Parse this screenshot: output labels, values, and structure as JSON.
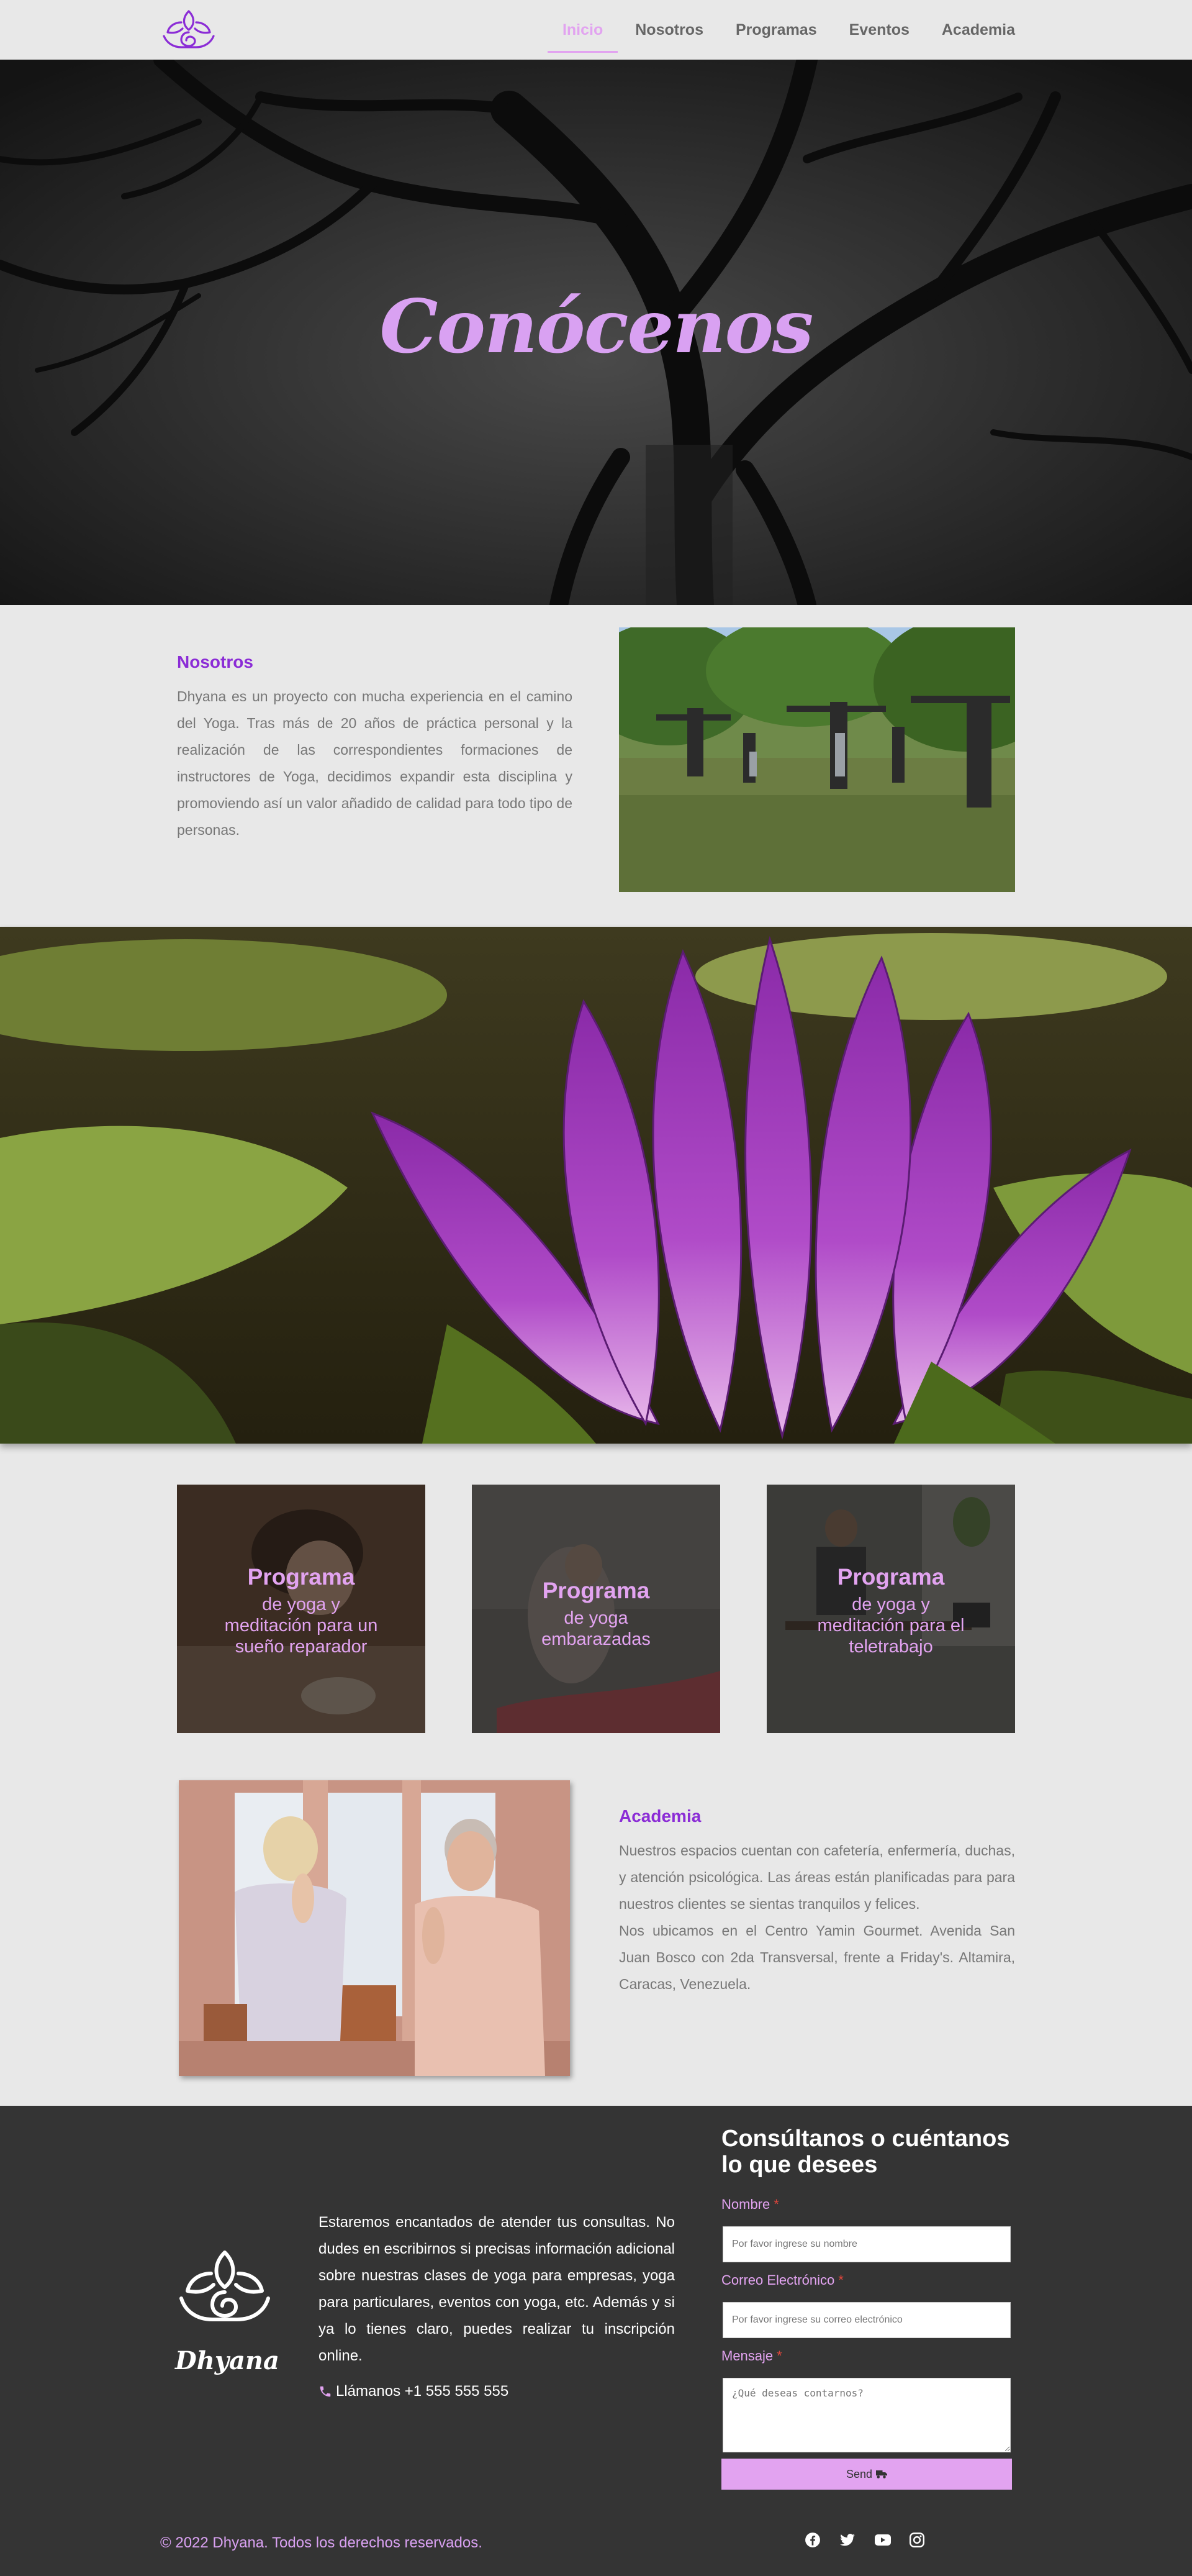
{
  "nav": {
    "items": [
      {
        "label": "Inicio",
        "active": true
      },
      {
        "label": "Nosotros"
      },
      {
        "label": "Programas"
      },
      {
        "label": "Eventos"
      },
      {
        "label": "Academia"
      }
    ]
  },
  "hero": {
    "title": "Conócenos"
  },
  "nosotros": {
    "title": "Nosotros",
    "text": "Dhyana es un proyecto con mucha experiencia en el camino del Yoga. Tras más de 20 años de práctica personal y la realización de las correspondientes formaciones de instructores de Yoga, decidimos expandir esta disciplina y promoviendo así un valor añadido de calidad para todo tipo de personas."
  },
  "programs": [
    {
      "title": "Programa",
      "subtitle": "de yoga y meditación para un sueño reparador"
    },
    {
      "title": "Programa",
      "subtitle": "de yoga embarazadas"
    },
    {
      "title": "Programa",
      "subtitle": "de yoga y meditación para el teletrabajo"
    }
  ],
  "academia": {
    "title": "Academia",
    "text1": "Nuestros espacios cuentan con cafetería, enfermería, duchas, y atención psicológica. Las áreas están planificadas para para nuestros clientes se sientas tranquilos y felices.",
    "text2": "Nos ubicamos en el Centro Yamin Gourmet. Avenida San Juan Bosco con 2da Transversal, frente a Friday's. Altamira, Caracas, Venezuela."
  },
  "footer": {
    "brand": "Dhyana",
    "text": "Estaremos encantados de atender tus consultas. No dudes en escribirnos si precisas información adicional sobre nuestras clases de yoga para empresas, yoga para particulares, eventos con yoga, etc. Además y si ya lo tienes claro, puedes realizar tu inscripción online.",
    "phone": "Llámanos +1 555 555 555",
    "form": {
      "title": "Consúltanos o cuéntanos lo que desees",
      "name_label": "Nombre",
      "name_placeholder": "Por favor ingrese su nombre",
      "email_label": "Correo Electrónico",
      "email_placeholder": "Por favor ingrese su correo electrónico",
      "message_label": "Mensaje",
      "message_placeholder": "¿Qué deseas contarnos?",
      "required_mark": "*",
      "send_label": "Send"
    },
    "copyright": "© 2022 Dhyana. Todos los derechos reservados.",
    "social_icons": [
      "facebook-icon",
      "twitter-icon",
      "youtube-icon",
      "instagram-icon"
    ]
  },
  "colors": {
    "accent": "#e2a3f0",
    "title_purple": "#8b2cd6",
    "footer_bg": "#343434"
  }
}
